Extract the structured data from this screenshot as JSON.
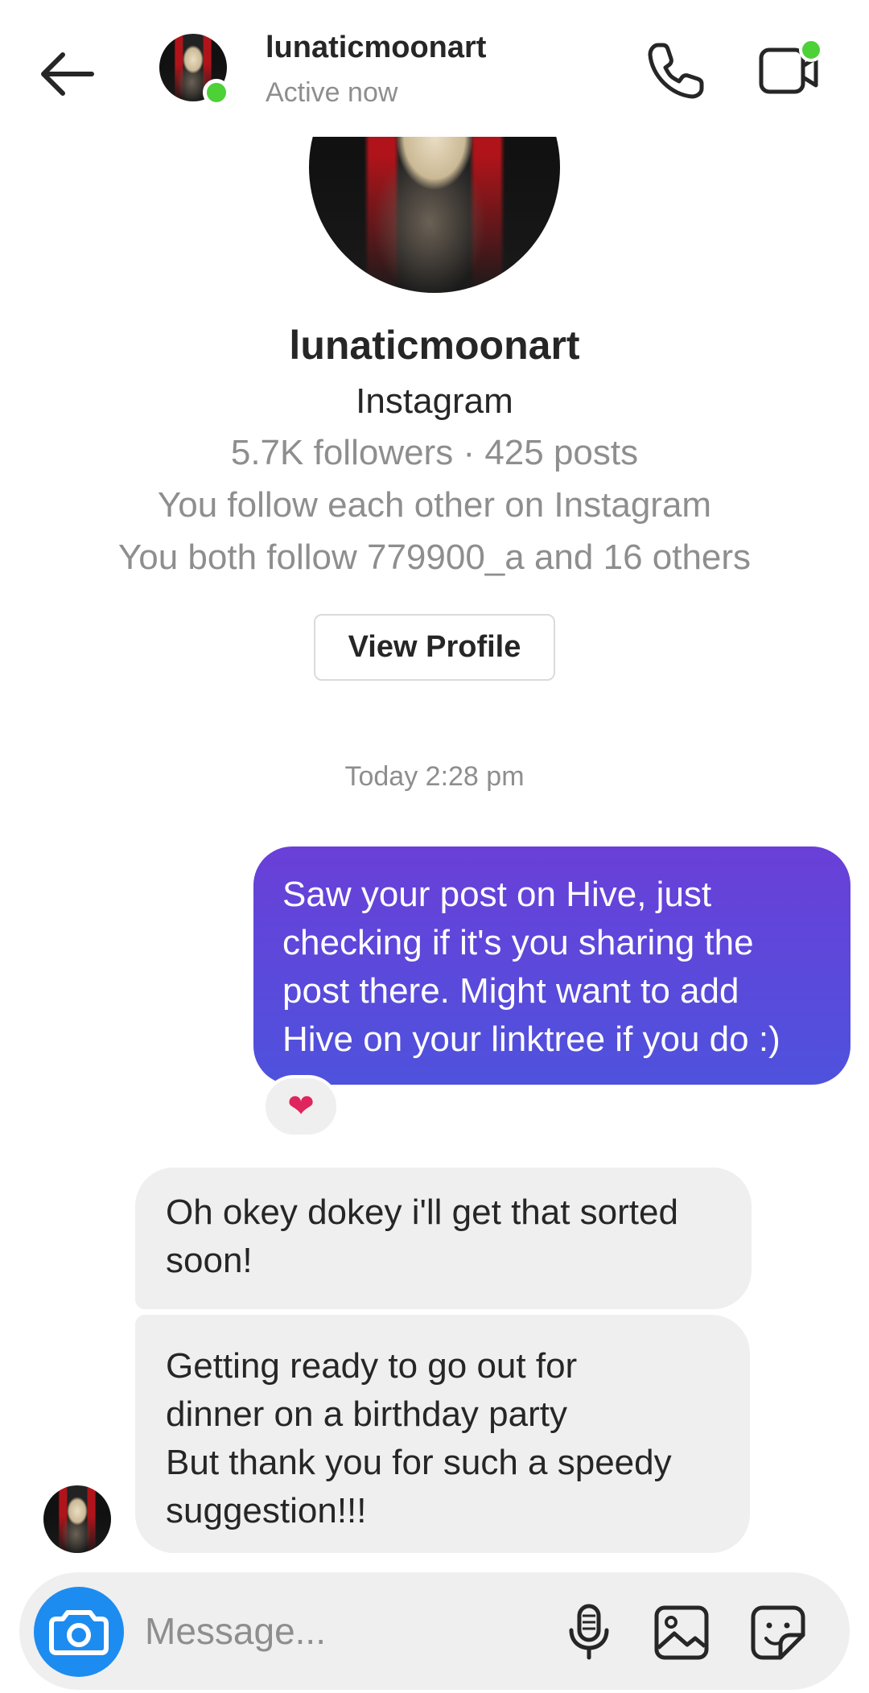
{
  "header": {
    "username": "lunaticmoonart",
    "status": "Active now",
    "icons": {
      "back": "back-arrow-icon",
      "call": "phone-icon",
      "video": "video-camera-icon"
    },
    "online_color": "#4cd137"
  },
  "profile": {
    "username": "lunaticmoonart",
    "source": "Instagram",
    "stats": "5.7K followers · 425 posts",
    "mutual": "You follow each other on Instagram",
    "both_follow": "You both follow 779900_a and 16 others",
    "view_profile_label": "View Profile"
  },
  "thread": {
    "timestamp": "Today 2:28 pm",
    "messages": [
      {
        "direction": "outgoing",
        "text": "Saw your post on Hive, just checking if it's you sharing the post there. Might want to add Hive on your linktree if you do :)",
        "lines": [
          "Saw your post on Hive, just",
          "checking if it's you sharing the",
          "post there. Might want to add",
          "Hive on your linktree if you do :)"
        ],
        "reaction": "❤"
      },
      {
        "direction": "incoming",
        "lines": [
          "Oh okey dokey i'll get that sorted",
          "soon!"
        ]
      },
      {
        "direction": "incoming",
        "lines": [
          "Getting ready to go out for",
          "dinner on a birthday party",
          "But thank you for such a speedy",
          "suggestion!!!"
        ]
      }
    ],
    "outgoing_gradient": [
      "#6a3fd8",
      "#4e52dd"
    ]
  },
  "composer": {
    "placeholder": "Message...",
    "value": "",
    "icons": {
      "camera": "camera-icon",
      "mic": "microphone-icon",
      "gallery": "gallery-icon",
      "sticker": "sticker-icon"
    },
    "camera_color": "#1d8cf0"
  }
}
